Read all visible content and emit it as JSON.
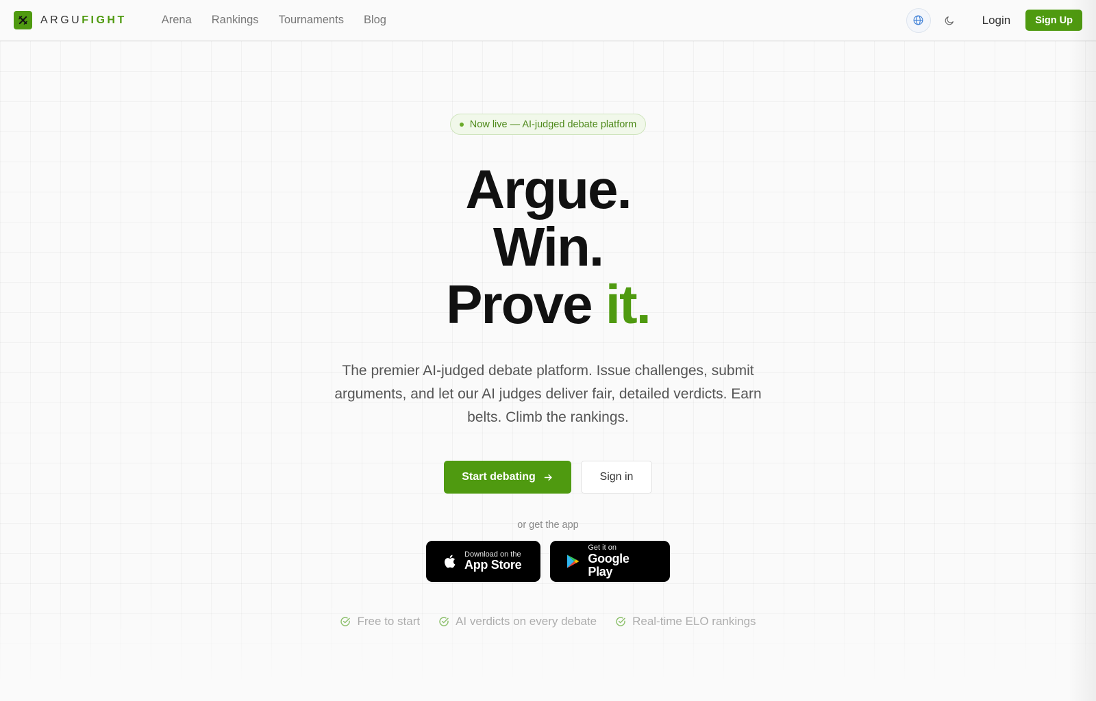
{
  "brand": {
    "part1": "ARGU",
    "part2": "FIGHT",
    "accent_color": "#4f9a10"
  },
  "nav": {
    "links": [
      {
        "label": "Arena"
      },
      {
        "label": "Rankings"
      },
      {
        "label": "Tournaments"
      },
      {
        "label": "Blog"
      }
    ],
    "globe_icon": "globe-icon",
    "theme_icon": "moon-icon",
    "login_label": "Login",
    "signup_label": "Sign Up"
  },
  "hero": {
    "badge": "Now live — AI-judged debate platform",
    "headline": {
      "line1": "Argue.",
      "line2": "Win.",
      "line3_start": "Prove ",
      "line3_accent": "it."
    },
    "subtitle": "The premier AI-judged debate platform. Issue challenges, submit arguments, and let our AI judges deliver fair, detailed verdicts. Earn belts. Climb the rankings.",
    "primary_cta": "Start debating",
    "secondary_cta": "Sign in",
    "get_app": "or get the app",
    "app_store": {
      "small": "Download on the",
      "big": "App Store"
    },
    "google_play": {
      "small": "Get it on",
      "big": "Google Play"
    },
    "features": [
      {
        "label": "Free to start"
      },
      {
        "label": "AI verdicts on every debate"
      },
      {
        "label": "Real-time ELO rankings"
      }
    ]
  }
}
